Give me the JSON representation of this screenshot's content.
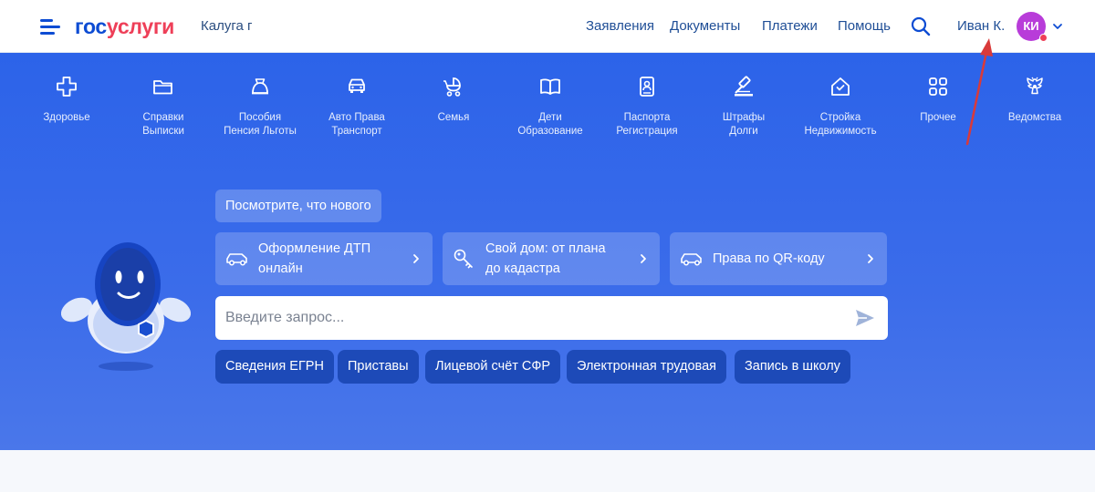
{
  "header": {
    "logo_part1": "гос",
    "logo_part2": "услуги",
    "city": "Калуга г",
    "nav": [
      {
        "label": "Заявления"
      },
      {
        "label": "Документы"
      },
      {
        "label": "Платежи"
      },
      {
        "label": "Помощь"
      }
    ],
    "user_name": "Иван К.",
    "avatar_initials": "КИ"
  },
  "categories": [
    {
      "line1": "Здоровье",
      "line2": "",
      "icon": "plus-cross-icon"
    },
    {
      "line1": "Справки",
      "line2": "Выписки",
      "icon": "folder-icon"
    },
    {
      "line1": "Пособия",
      "line2": "Пенсия Льготы",
      "icon": "bell-money-icon"
    },
    {
      "line1": "Авто Права",
      "line2": "Транспорт",
      "icon": "car-icon"
    },
    {
      "line1": "Семья",
      "line2": "",
      "icon": "stroller-icon"
    },
    {
      "line1": "Дети",
      "line2": "Образование",
      "icon": "book-icon"
    },
    {
      "line1": "Паспорта",
      "line2": "Регистрация",
      "icon": "passport-icon"
    },
    {
      "line1": "Штрафы",
      "line2": "Долги",
      "icon": "gavel-icon"
    },
    {
      "line1": "Стройка",
      "line2": "Недвижимость",
      "icon": "house-icon"
    },
    {
      "line1": "Прочее",
      "line2": "",
      "icon": "grid-icon"
    },
    {
      "line1": "Ведомства",
      "line2": "",
      "icon": "eagle-emblem-icon"
    }
  ],
  "news_button": "Посмотрите, что нового",
  "cards": [
    {
      "line1": "Оформление ДТП",
      "line2": "онлайн",
      "icon": "car-icon"
    },
    {
      "line1": "Свой дом: от плана",
      "line2": "до кадастра",
      "icon": "key-icon"
    },
    {
      "line1": "Права по QR-коду",
      "line2": "",
      "icon": "car-icon"
    }
  ],
  "search": {
    "placeholder": "Введите запрос...",
    "value": ""
  },
  "chips": [
    {
      "label": "Сведения ЕГРН"
    },
    {
      "label": "Приставы"
    },
    {
      "label": "Лицевой счёт СФР"
    },
    {
      "label": "Электронная трудовая"
    },
    {
      "label": "Запись в школу"
    }
  ],
  "colors": {
    "brand_blue": "#0d4cd3",
    "brand_red": "#ee3f58",
    "hero_blue": "#2c63e9",
    "avatar_purple": "#b83cd9",
    "chip_blue": "#1d4ab8"
  }
}
